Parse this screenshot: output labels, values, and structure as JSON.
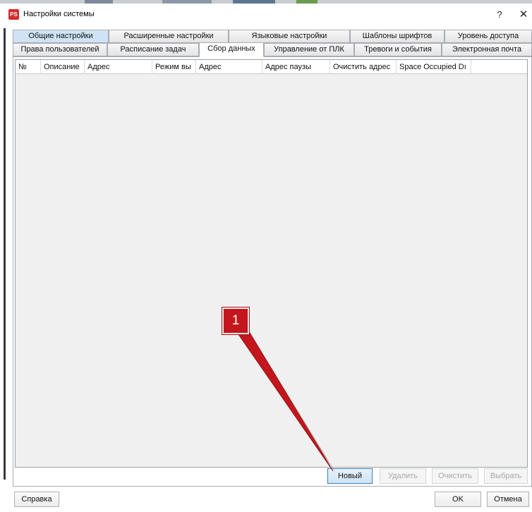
{
  "window": {
    "icon_text": "PS",
    "title": "Настройки системы",
    "help_label": "?",
    "close_label": "✕"
  },
  "tabs_row1": [
    {
      "label": "Общие настройки",
      "active": true
    },
    {
      "label": "Расширенные настройки"
    },
    {
      "label": "Языковые настройки"
    },
    {
      "label": "Шаблоны шрифтов"
    },
    {
      "label": "Уровень доступа"
    }
  ],
  "tabs_row2": [
    {
      "label": "Права пользователей"
    },
    {
      "label": "Расписание задач"
    },
    {
      "label": "Сбор данных",
      "active": true
    },
    {
      "label": "Управление от ПЛК"
    },
    {
      "label": "Тревоги и события"
    },
    {
      "label": "Электронная почта"
    }
  ],
  "grid": {
    "columns": [
      "№",
      "Описание",
      "Адрес",
      "Режим вы",
      "Адрес",
      "Адрес паузы",
      "Очистить адрес",
      "Space Occupied Dı"
    ],
    "rows": []
  },
  "actions": {
    "new_label": "Новый",
    "delete_label": "Удалить",
    "clear_label": "Очистить",
    "select_label": "Выбрать"
  },
  "footer": {
    "help_label": "Справка",
    "ok_label": "OK",
    "cancel_label": "Отмена"
  },
  "callout": {
    "number": "1",
    "color": "#c4161c"
  },
  "colors": {
    "active_top_tab": "#cfe3f4",
    "grid_background": "#f0f0f0",
    "accent_border": "#3c7fb1"
  },
  "icons": [
    "app-icon",
    "help-icon",
    "close-icon"
  ]
}
